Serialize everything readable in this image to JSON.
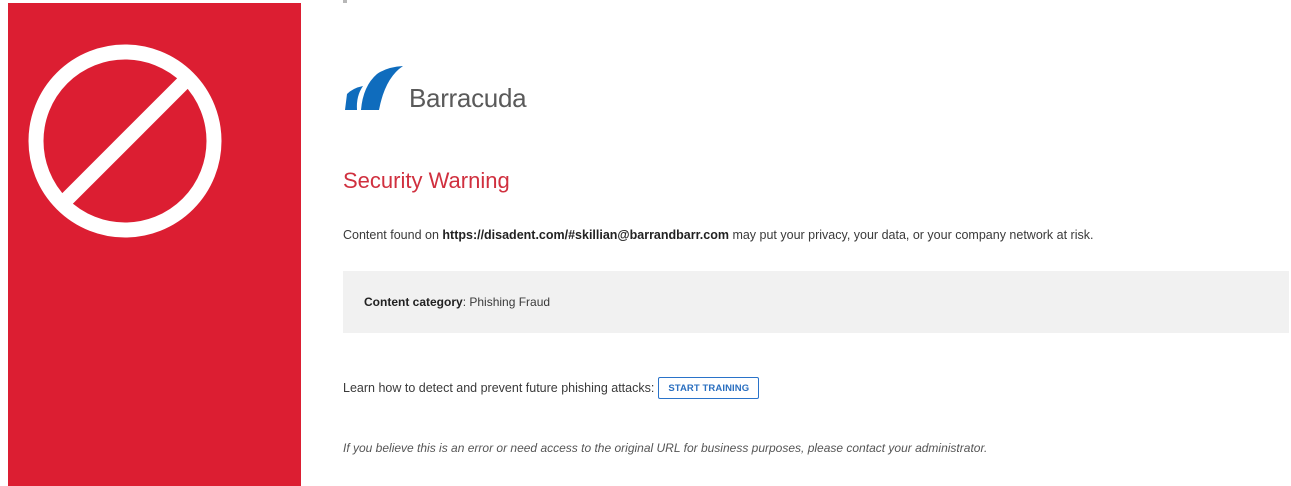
{
  "brand": {
    "name": "Barracuda",
    "logo_color": "#0f6cbd"
  },
  "colors": {
    "panel_red": "#dc1e32",
    "title_red": "#d0303f",
    "button_blue": "#2a73c9",
    "category_bg": "#f1f1f1"
  },
  "warning": {
    "title": "Security Warning",
    "message_prefix": "Content found on ",
    "url": "https://disadent.com/#skillian@barrandbarr.com",
    "message_suffix": " may put your privacy, your data, or your company network at risk."
  },
  "category": {
    "label": "Content category",
    "separator": ":",
    "value": " Phishing Fraud"
  },
  "training": {
    "prompt": "Learn how to detect and prevent future phishing attacks:",
    "button_label": "START TRAINING"
  },
  "note": "If you believe this is an error or need access to the original URL for business purposes, please contact your administrator.",
  "icons": {
    "prohibited": "prohibited-icon"
  }
}
